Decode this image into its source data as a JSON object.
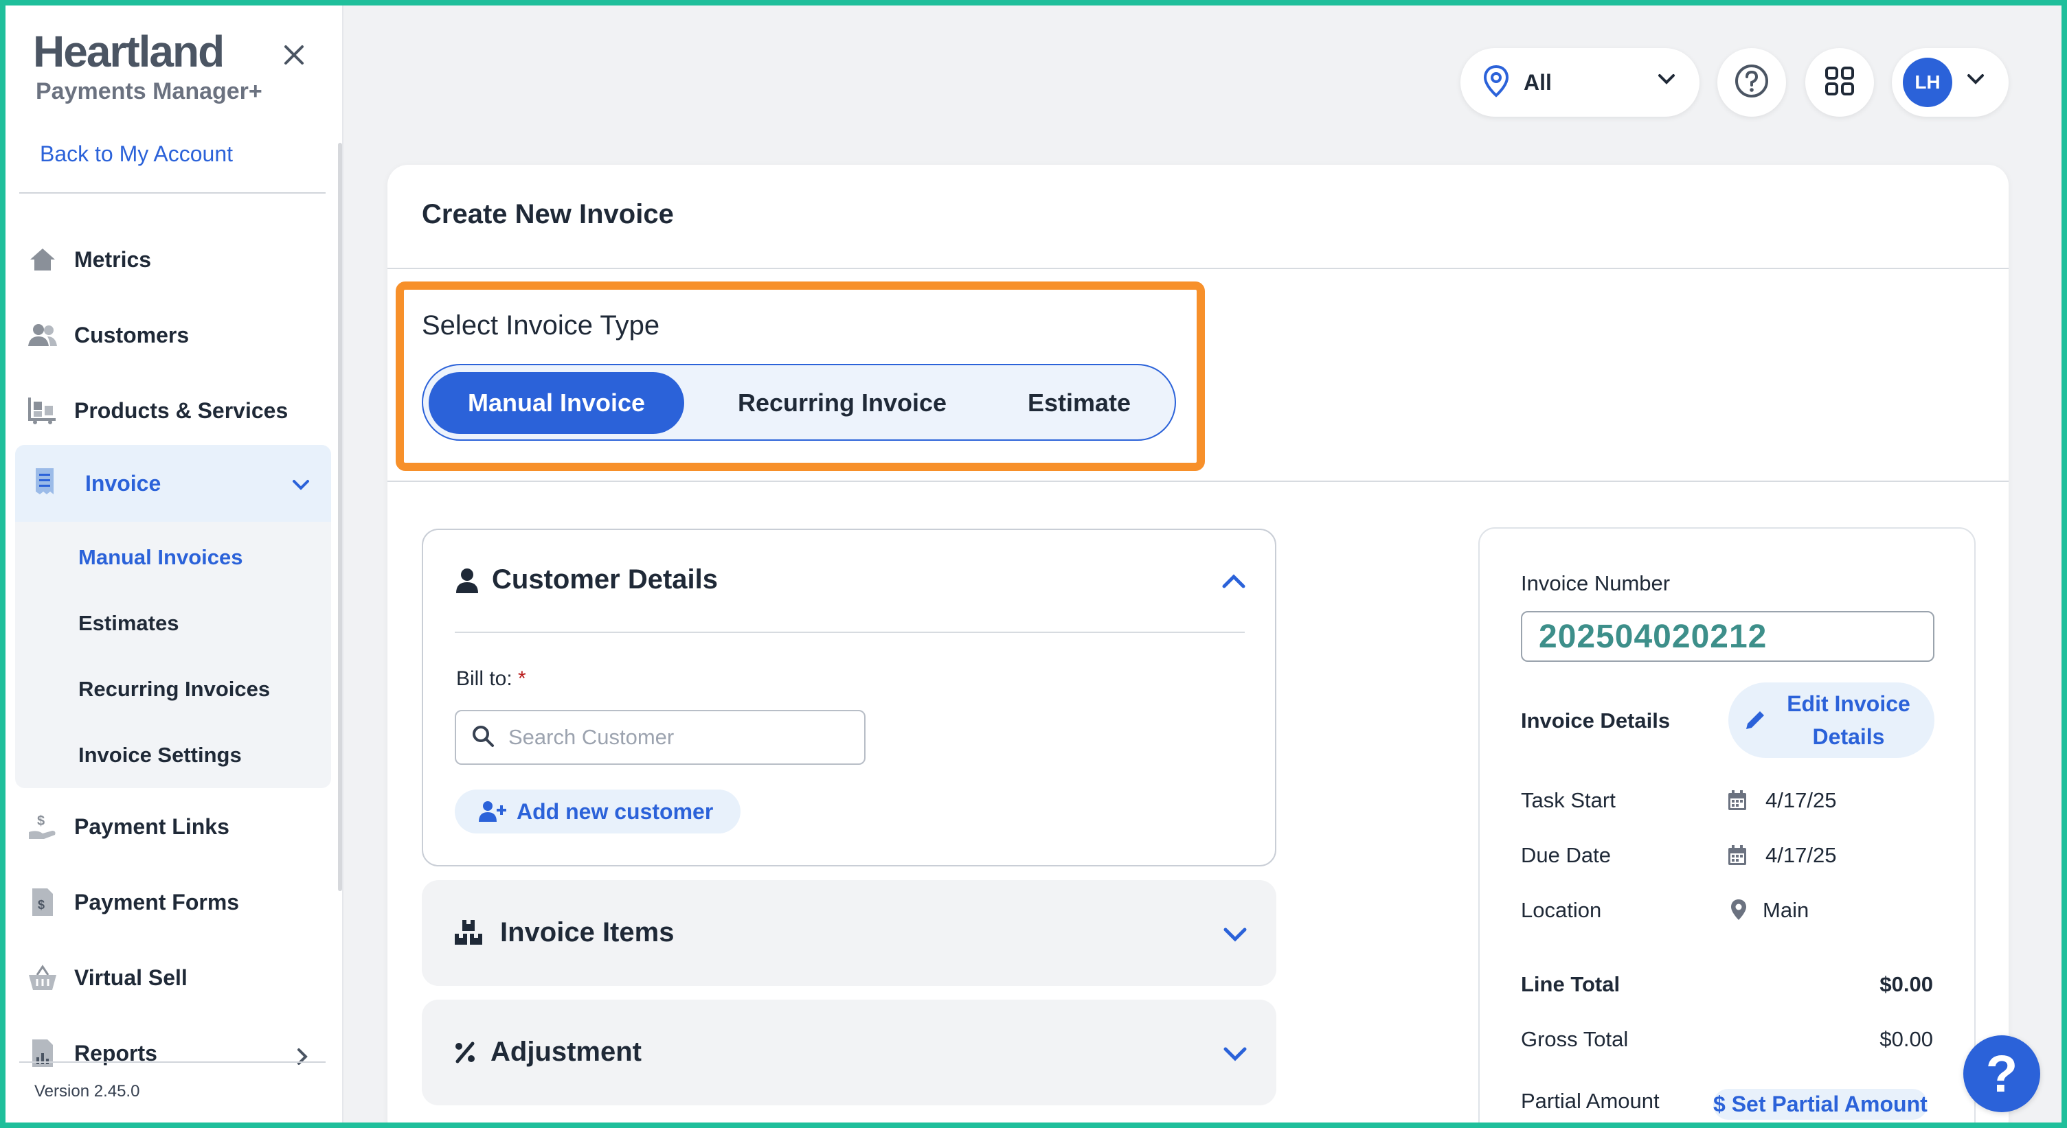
{
  "sidebar": {
    "brand_title": "Heartland",
    "brand_subtitle": "Payments Manager+",
    "back_link": "Back to My Account",
    "items": {
      "metrics": "Metrics",
      "customers": "Customers",
      "products": "Products & Services",
      "invoice": "Invoice",
      "payment_links": "Payment Links",
      "payment_forms": "Payment Forms",
      "virtual_sell": "Virtual Sell",
      "reports": "Reports"
    },
    "invoice_sub": {
      "manual": "Manual Invoices",
      "estimates": "Estimates",
      "recurring": "Recurring Invoices",
      "settings": "Invoice Settings"
    },
    "version": "Version 2.45.0"
  },
  "topbar": {
    "location_value": "All",
    "avatar_initials": "LH"
  },
  "main": {
    "title": "Create New Invoice",
    "type_label": "Select Invoice Type",
    "types": {
      "manual": "Manual Invoice",
      "recurring": "Recurring Invoice",
      "estimate": "Estimate"
    },
    "customer": {
      "title": "Customer Details",
      "bill_to": "Bill to:",
      "required_mark": "*",
      "search_placeholder": "Search Customer",
      "add_new": "Add new customer"
    },
    "items_title": "Invoice Items",
    "adjustment_title": "Adjustment"
  },
  "summary": {
    "invoice_number_label": "Invoice Number",
    "invoice_number": "202504020212",
    "invoice_details_label": "Invoice Details",
    "edit_button": "Edit Invoice Details",
    "task_start_label": "Task Start",
    "task_start": "4/17/25",
    "due_date_label": "Due Date",
    "due_date": "4/17/25",
    "location_label": "Location",
    "location": "Main",
    "line_total_label": "Line Total",
    "line_total": "$0.00",
    "gross_total_label": "Gross Total",
    "gross_total": "$0.00",
    "partial_amount_label": "Partial Amount",
    "set_partial": "Set Partial Amount",
    "dollar_sign": "$"
  },
  "help": {
    "label": "?"
  },
  "colors": {
    "accent": "#2b62d9",
    "highlight_border": "#f7902a",
    "frame": "#1fbf9b",
    "invoice_number": "#3d8f8a"
  }
}
